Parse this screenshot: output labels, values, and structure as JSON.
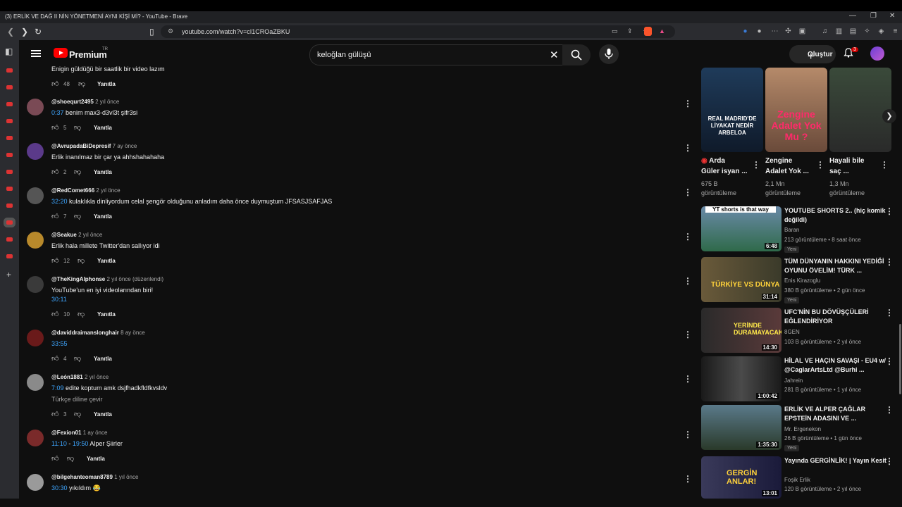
{
  "window": {
    "title": "(3) ERLİK VE DAĞ II NİN YÖNETMENİ AYNI KİŞİ Mİ? - YouTube - Brave"
  },
  "browser": {
    "url": "youtube.com/watch?v=cI1CROaZBKU"
  },
  "header": {
    "logo_text": "Premium",
    "region": "TR",
    "search_value": "keloğlan gülüşü",
    "create_label": "Oluştur",
    "notif_count": "3"
  },
  "top_comment": {
    "text": "Enigin güldüğü bir saatlik bir video lazım",
    "likes": "48",
    "reply": "Yanıtla"
  },
  "comments": [
    {
      "handle": "@shoequrt2495",
      "time": "2 yıl önce",
      "ts": "0:37",
      "text": " benim max3-d3vl3t şifr3si",
      "likes": "5",
      "reply": "Yanıtla"
    },
    {
      "handle": "@AvrupadaBiDepresif",
      "time": "7 ay önce",
      "ts": "",
      "text": "Erlik inanılmaz bir çar ya ahhshahahaha",
      "likes": "2",
      "reply": "Yanıtla"
    },
    {
      "handle": "@RedComet666",
      "time": "2 yıl önce",
      "ts": "32:20",
      "text": " kulaklıkla dinliyordum celal şengör olduğunu anladım daha önce duymuştum JFSASJSAFJAS",
      "likes": "7",
      "reply": "Yanıtla"
    },
    {
      "handle": "@Seakue",
      "time": "2 yıl önce",
      "ts": "",
      "text": "Erlik hala millete Twitter'dan sallıyor idi",
      "likes": "12",
      "reply": "Yanıtla"
    },
    {
      "handle": "@TheKingAlphonse",
      "time": "2 yıl önce (düzenlendi)",
      "ts": "",
      "text": "YouTube'un en iyi videolarından biri!",
      "ts2": "30:11",
      "likes": "10",
      "reply": "Yanıtla"
    },
    {
      "handle": "@daviddraimanslonghair",
      "time": "8 ay önce",
      "ts": "33:55",
      "text": "",
      "likes": "4",
      "reply": "Yanıtla"
    },
    {
      "handle": "@León1881",
      "time": "2 yıl önce",
      "ts": "7:09",
      "text": " edite koptum amk dsjfhadkfldfkvsldv",
      "translate": "Türkçe diline çevir",
      "likes": "3",
      "reply": "Yanıtla"
    },
    {
      "handle": "@Fexion01",
      "time": "1 ay önce",
      "ts": "11:10",
      "ts_b": "19:50",
      "text": " Alper Şiirler",
      "likes": "",
      "reply": "Yanıtla"
    },
    {
      "handle": "@bilgehanteoman8789",
      "time": "1 yıl önce",
      "ts": "30:30",
      "text": " yıkıldım 😂",
      "likes": "",
      "reply": ""
    }
  ],
  "shorts": [
    {
      "title1": "Arda",
      "title2": "Güler isyan ...",
      "views": "675 B",
      "views2": "görüntüleme",
      "thumb": "REAL MADRID'DE LİYAKAT NEDİR ARBELOA"
    },
    {
      "title1": "Zengine",
      "title2": "Adalet Yok ...",
      "views": "2,1 Mn",
      "views2": "görüntüleme",
      "thumb": "Zengine Adalet Yok Mu ?"
    },
    {
      "title1": "Hayali bile",
      "title2": "saç ...",
      "views": "1,3 Mn",
      "views2": "görüntüleme",
      "thumb": ""
    }
  ],
  "videos": [
    {
      "title": "YOUTUBE SHORTS 2.. (hiç komik değildi)",
      "channel": "Baran",
      "meta": "213 görüntüleme • 8 saat önce",
      "new": "Yeni",
      "dur": "6:48",
      "thumb": "YT shorts is that way"
    },
    {
      "title": "TÜM DÜNYANIN HAKKINI YEDİĞİ OYUNU ÖVELİM! TÜRK ...",
      "channel": "Enis Kirazoglu",
      "meta": "380 B görüntüleme • 2 gün önce",
      "new": "Yeni",
      "dur": "31:14",
      "thumb": "TÜRKİYE VS DÜNYA"
    },
    {
      "title": "UFC'NİN BU DÖVÜŞÇÜLERİ EĞLENDİRİYOR",
      "channel": "8GEN",
      "meta": "103 B görüntüleme • 2 yıl önce",
      "new": "",
      "dur": "14:30",
      "thumb": "YERİNDE DURAMAYACAKSIN"
    },
    {
      "title": "HİLAL VE HAÇIN SAVAŞI - EU4 w/ @CaglarArtsLtd @Burhi ...",
      "channel": "Jahrein",
      "meta": "281 B görüntüleme • 1 yıl önce",
      "new": "",
      "dur": "1:00:42",
      "thumb": ""
    },
    {
      "title": "ERLİK VE ALPER ÇAĞLAR EPSTEİN ADASINI VE ...",
      "channel": "Mr. Ergenekon",
      "meta": "26 B görüntüleme • 1 gün önce",
      "new": "Yeni",
      "dur": "1:35:30",
      "thumb": ""
    },
    {
      "title": "Yayında GERGİNLİK! | Yayın Kesit",
      "channel": "Foşik Erlik",
      "meta": "120 B görüntüleme • 2 yıl önce",
      "new": "",
      "dur": "13:01",
      "thumb": "GERGİN ANLAR!"
    }
  ]
}
